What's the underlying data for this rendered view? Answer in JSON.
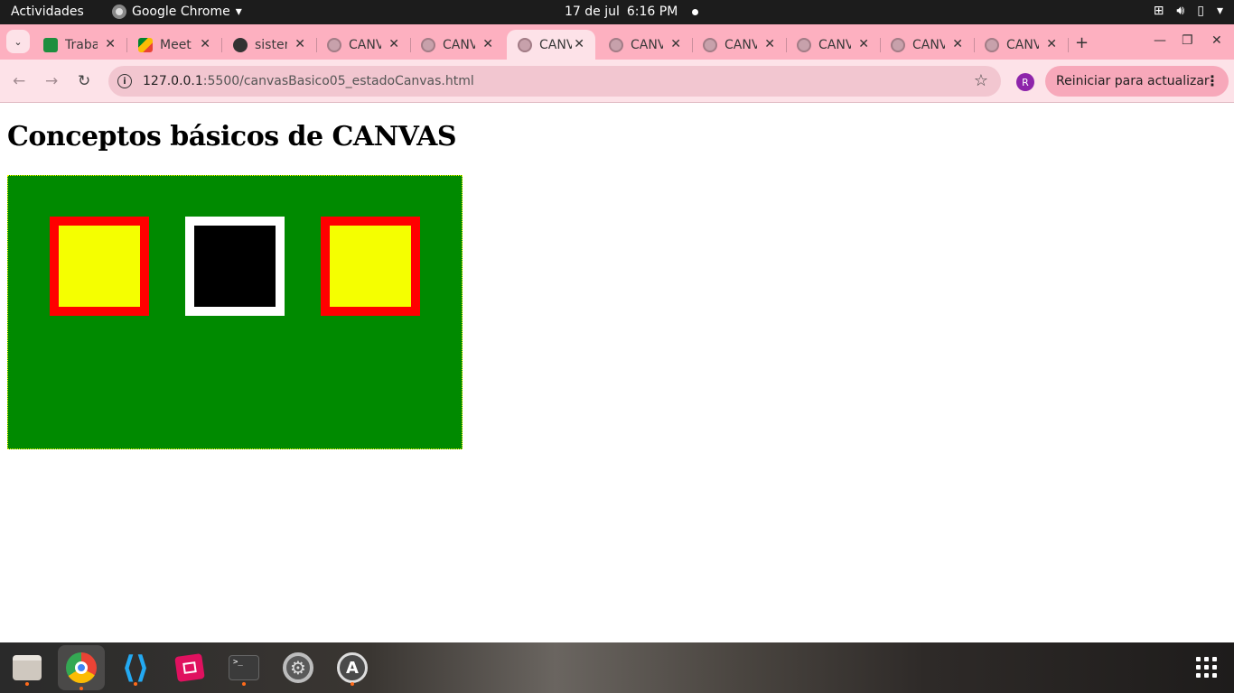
{
  "topbar": {
    "activities": "Actividades",
    "app_name": "Google Chrome",
    "date": "17 de jul",
    "time": "6:16 PM"
  },
  "tabs": [
    {
      "title": "Trabajo",
      "icon": "google-sheets-icon"
    },
    {
      "title": "Meet",
      "icon": "google-meet-icon"
    },
    {
      "title": "sistemas",
      "icon": "github-icon"
    },
    {
      "title": "CANVAS",
      "icon": "globe-icon"
    },
    {
      "title": "CANVAS",
      "icon": "globe-icon"
    },
    {
      "title": "CANVAS",
      "icon": "globe-icon",
      "active": true
    },
    {
      "title": "CANVAS",
      "icon": "globe-icon"
    },
    {
      "title": "CANVAS",
      "icon": "globe-icon"
    },
    {
      "title": "CANVAS",
      "icon": "globe-icon"
    },
    {
      "title": "CANVAS",
      "icon": "globe-icon"
    },
    {
      "title": "CANVAS",
      "icon": "globe-icon"
    }
  ],
  "toolbar": {
    "url_host": "127.0.0.1",
    "url_path": ":5500/canvasBasico05_estadoCanvas.html",
    "profile_initial": "R",
    "restart_label": "Reiniciar para actualizar"
  },
  "page": {
    "heading": "Conceptos básicos de CANVAS"
  },
  "canvas": {
    "background": "#008a00",
    "border_color": "#ffff00",
    "squares": [
      {
        "fill": "#f5ff00",
        "stroke": "#ff0000"
      },
      {
        "fill": "#000000",
        "stroke": "#ffffff"
      },
      {
        "fill": "#f5ff00",
        "stroke": "#ff0000"
      }
    ]
  },
  "dock": {
    "apps": [
      "files-icon",
      "chrome-icon",
      "vscode-icon",
      "screenshot-crop-icon",
      "terminal-icon",
      "settings-icon",
      "software-updater-icon"
    ],
    "show_apps": "show-apps-grid-icon"
  }
}
